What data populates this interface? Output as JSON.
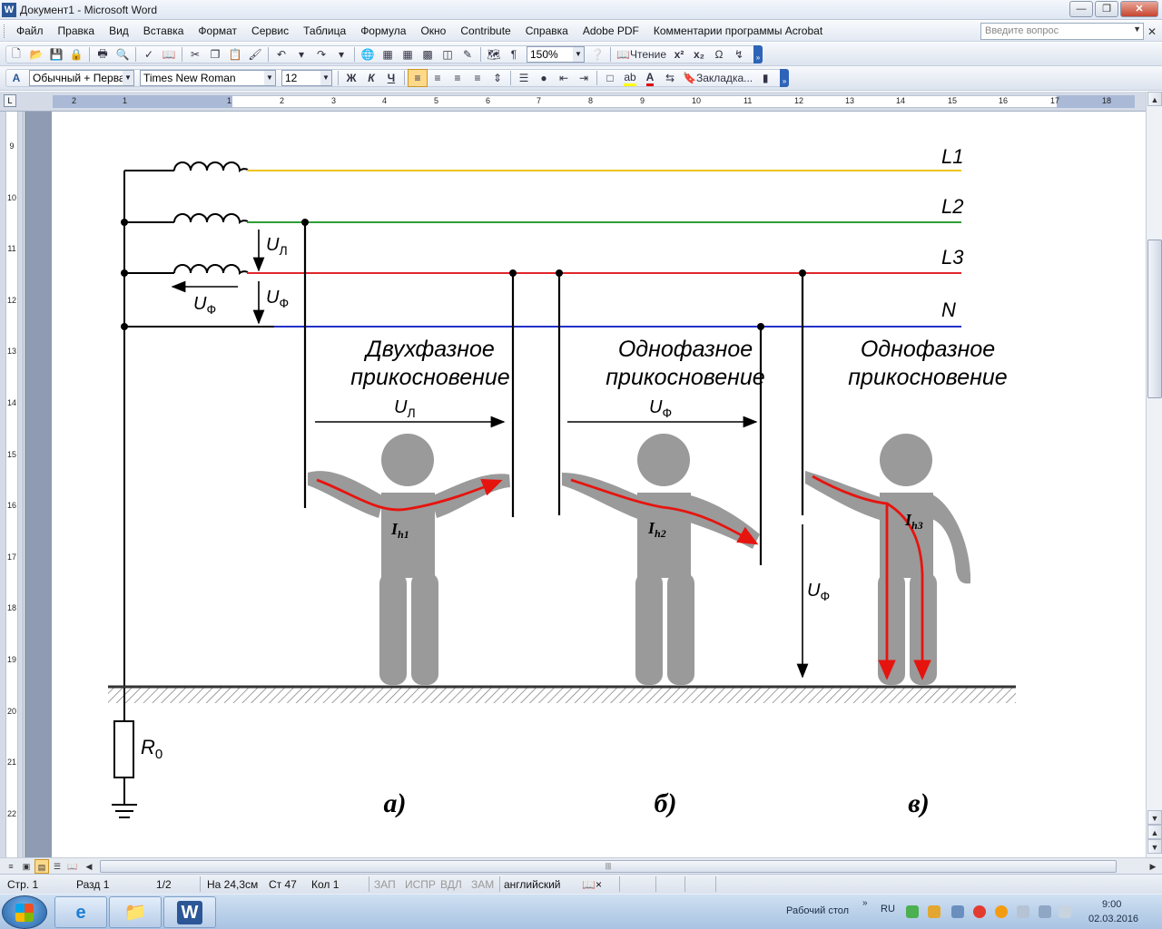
{
  "window": {
    "title": "Документ1 - Microsoft Word",
    "app_icon": "word-icon",
    "buttons": [
      "minimize",
      "restore",
      "close"
    ]
  },
  "menu": {
    "items": [
      "Файл",
      "Правка",
      "Вид",
      "Вставка",
      "Формат",
      "Сервис",
      "Таблица",
      "Формула",
      "Окно",
      "Contribute",
      "Справка",
      "Adobe PDF",
      "Комментарии программы Acrobat"
    ],
    "help_placeholder": "Введите вопрос"
  },
  "toolbar_standard": {
    "zoom": "150%",
    "reading_label": "Чтение"
  },
  "toolbar_formatting": {
    "style": "Обычный + Перва",
    "font": "Times New Roman",
    "size": "12",
    "bold": "Ж",
    "italic": "К",
    "underline": "Ч",
    "bookmark_label": "Закладка..."
  },
  "ruler": {
    "horizontal_ticks": [
      "2",
      "1",
      "1",
      "2",
      "3",
      "4",
      "5",
      "6",
      "7",
      "8",
      "9",
      "10",
      "11",
      "12",
      "13",
      "14",
      "15",
      "16",
      "17",
      "18"
    ],
    "vertical_ticks": [
      "9",
      "10",
      "11",
      "12",
      "13",
      "14",
      "15",
      "16",
      "17",
      "18",
      "19",
      "20",
      "21",
      "22"
    ]
  },
  "figure": {
    "lines": {
      "l1": "L1",
      "l2": "L2",
      "l3": "L3",
      "n": "N"
    },
    "line_colors": {
      "l1": "#f0c419",
      "l2": "#2e9e36",
      "l3": "#e0262b",
      "n": "#2231c8"
    },
    "voltage_symbol": "U",
    "line_subscript": "Л",
    "phase_subscript": "Ф",
    "resistor_symbol": "R",
    "resistor_subscript": "0",
    "case_a": {
      "title_line1": "Двухфазное",
      "title_line2": "прикосновение",
      "current_base": "I",
      "current_sub": "h1",
      "caption": "а)"
    },
    "case_b": {
      "title_line1": "Однофазное",
      "title_line2": "прикосновение",
      "current_base": "I",
      "current_sub": "h2",
      "caption": "б)"
    },
    "case_c": {
      "title_line1": "Однофазное",
      "title_line2": "прикосновение",
      "current_base": "I",
      "current_sub": "h3",
      "caption": "в)"
    }
  },
  "status": {
    "page": "Стр. 1",
    "section": "Разд 1",
    "pages": "1/2",
    "at": "На 24,3см",
    "line": "Ст 47",
    "col": "Кол 1",
    "rec": "ЗАП",
    "trk": "ИСПР",
    "ext": "ВДЛ",
    "ovr": "ЗАМ",
    "language": "английский"
  },
  "taskbar": {
    "desktop_label": "Рабочий стол",
    "lang": "RU",
    "time": "9:00",
    "date": "02.03.2016"
  }
}
